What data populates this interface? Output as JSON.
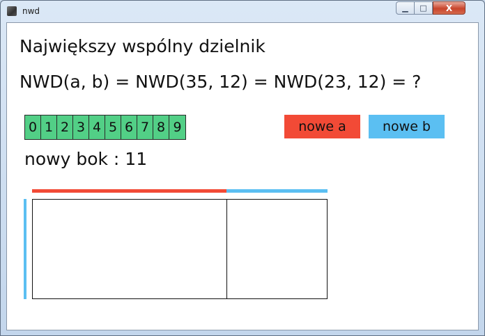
{
  "window": {
    "title": "nwd"
  },
  "controls": {
    "minimize": "▁",
    "maximize": "□",
    "close": "X"
  },
  "content": {
    "heading": "Największy wspólny dzielnik",
    "formula": "NWD(a, b) = NWD(35, 12) = NWD(23, 12)  = ?",
    "digits": [
      "0",
      "1",
      "2",
      "3",
      "4",
      "5",
      "6",
      "7",
      "8",
      "9"
    ],
    "new_a_label": "nowe a",
    "new_b_label": "nowe b",
    "side_label": "nowy bok : 11"
  },
  "colors": {
    "digit_green": "#52cf86",
    "accent_red": "#f24a36",
    "accent_blue": "#5bbff2"
  }
}
